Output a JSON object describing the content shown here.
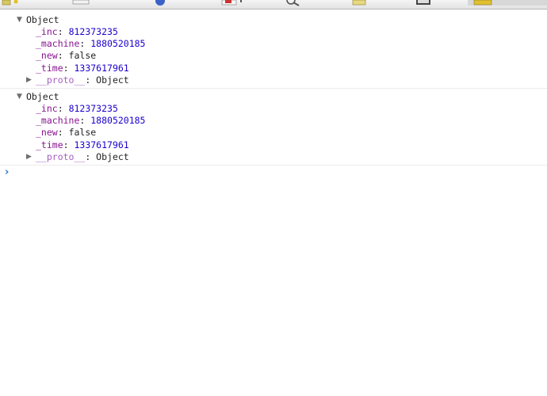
{
  "messages": [
    {
      "header": "Object",
      "props": [
        {
          "name": "_inc",
          "value": "812373235",
          "kind": "number"
        },
        {
          "name": "_machine",
          "value": "1880520185",
          "kind": "number"
        },
        {
          "name": "_new",
          "value": "false",
          "kind": "boolean"
        },
        {
          "name": "_time",
          "value": "1337617961",
          "kind": "number"
        }
      ],
      "proto": {
        "name": "__proto__",
        "value": "Object"
      }
    },
    {
      "header": "Object",
      "props": [
        {
          "name": "_inc",
          "value": "812373235",
          "kind": "number"
        },
        {
          "name": "_machine",
          "value": "1880520185",
          "kind": "number"
        },
        {
          "name": "_new",
          "value": "false",
          "kind": "boolean"
        },
        {
          "name": "_time",
          "value": "1337617961",
          "kind": "number"
        }
      ],
      "proto": {
        "name": "__proto__",
        "value": "Object"
      }
    }
  ],
  "prompt": "›",
  "icons": {
    "expanded": "▼",
    "collapsed": "▶"
  },
  "colors": {
    "property_name": "#881391",
    "number_value": "#1c00cf",
    "prompt": "#2a75c7"
  }
}
